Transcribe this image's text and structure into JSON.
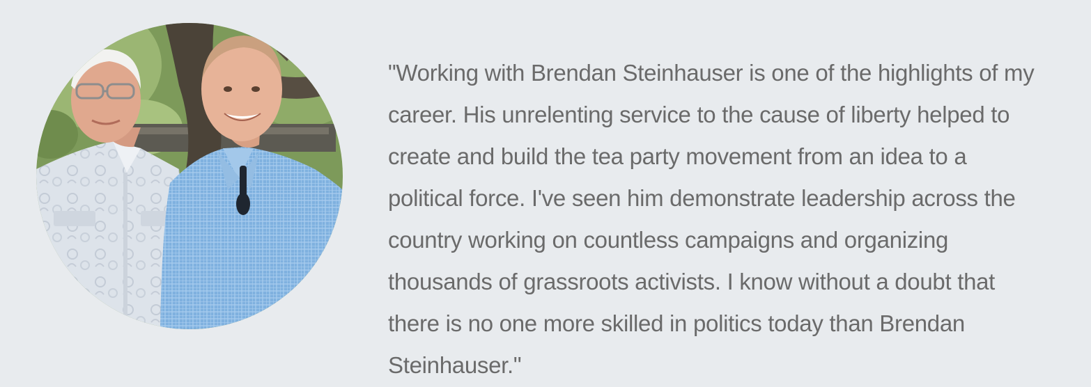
{
  "testimonial": {
    "photo_icon": "photo-of-two-men",
    "quote_lines": [
      "\"Working with Brendan Steinhauser is one of the highlights of my",
      "career. His unrelenting service to the cause of liberty helped to",
      "create and build the tea party movement from an idea to a",
      "political force. I've seen him demonstrate leadership across the",
      "country working on countless campaigns and organizing",
      "thousands of grassroots activists. I know without a doubt that",
      "there is no one more skilled in politics today than Brendan",
      "Steinhauser.\""
    ]
  },
  "colors": {
    "background": "#e8ebee",
    "quote_text": "#6a6a6a"
  }
}
